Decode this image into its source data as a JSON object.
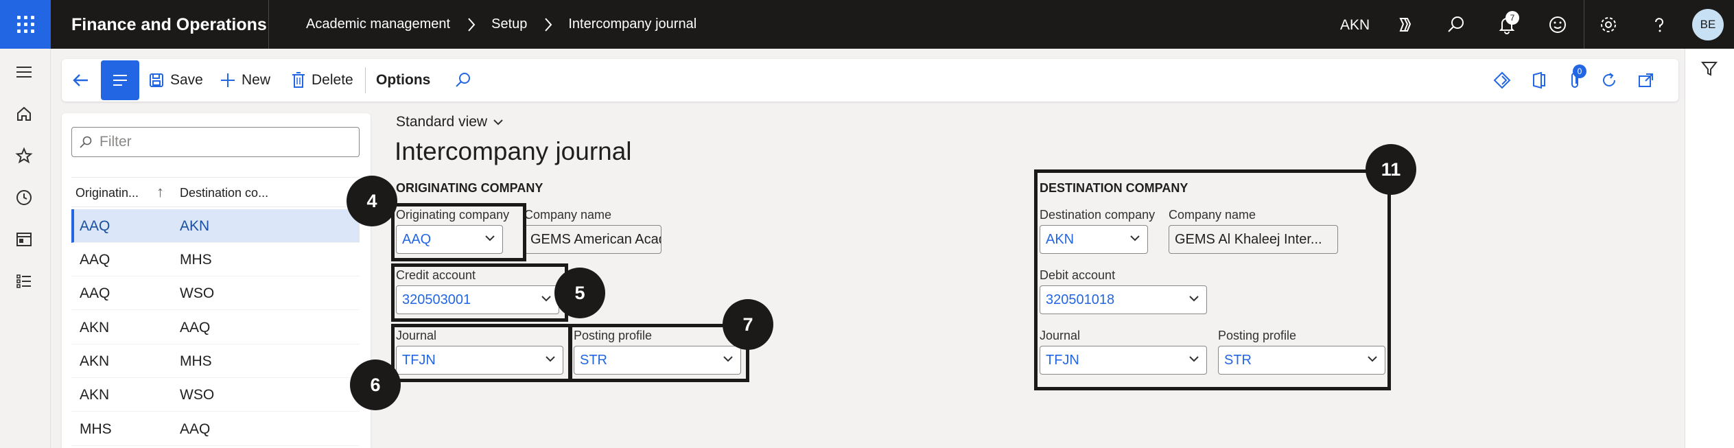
{
  "app": {
    "title": "Finance and Operations",
    "company": "AKN",
    "user_initials": "BE",
    "notifications": "7"
  },
  "breadcrumb": [
    "Academic management",
    "Setup",
    "Intercompany journal"
  ],
  "toolbar": {
    "save": "Save",
    "new": "New",
    "delete": "Delete",
    "options": "Options",
    "badge": "0"
  },
  "list": {
    "filter_placeholder": "Filter",
    "col1": "Originatin...",
    "col2": "Destination co...",
    "rows": [
      {
        "orig": "AAQ",
        "dest": "AKN"
      },
      {
        "orig": "AAQ",
        "dest": "MHS"
      },
      {
        "orig": "AAQ",
        "dest": "WSO"
      },
      {
        "orig": "AKN",
        "dest": "AAQ"
      },
      {
        "orig": "AKN",
        "dest": "MHS"
      },
      {
        "orig": "AKN",
        "dest": "WSO"
      },
      {
        "orig": "MHS",
        "dest": "AAQ"
      }
    ]
  },
  "view": {
    "name": "Standard view",
    "page_title": "Intercompany journal"
  },
  "originating": {
    "group": "ORIGINATING COMPANY",
    "company_label": "Originating company",
    "company_value": "AAQ",
    "name_label": "Company name",
    "name_value": "GEMS American Acade...",
    "account_label": "Credit account",
    "account_value": "320503001",
    "journal_label": "Journal",
    "journal_value": "TFJN",
    "posting_label": "Posting profile",
    "posting_value": "STR"
  },
  "destination": {
    "group": "DESTINATION COMPANY",
    "company_label": "Destination company",
    "company_value": "AKN",
    "name_label": "Company name",
    "name_value": "GEMS Al Khaleej Inter...",
    "account_label": "Debit account",
    "account_value": "320501018",
    "journal_label": "Journal",
    "journal_value": "TFJN",
    "posting_label": "Posting profile",
    "posting_value": "STR"
  },
  "callouts": {
    "c4": "4",
    "c5": "5",
    "c6": "6",
    "c7": "7",
    "c11": "11"
  },
  "colors": {
    "accent": "#2266e3",
    "topbar": "#1b1a19",
    "selected_row": "#dbe6f8"
  }
}
